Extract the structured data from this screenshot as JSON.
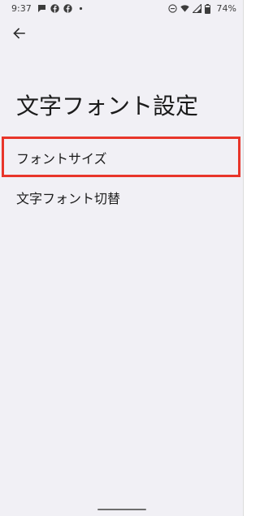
{
  "status_bar": {
    "time": "9:37",
    "battery_percent": "74%",
    "notification_icons": [
      "chat-bubble-icon",
      "facebook-icon",
      "facebook-icon",
      "dot-icon"
    ],
    "system_icons": [
      "do-not-disturb-icon",
      "wifi-icon",
      "signal-icon",
      "battery-icon"
    ]
  },
  "header": {
    "back_icon": "arrow-back-icon",
    "title": "文字フォント設定"
  },
  "settings": {
    "items": [
      {
        "label": "フォントサイズ",
        "highlighted": true
      },
      {
        "label": "文字フォント切替",
        "highlighted": false
      }
    ]
  },
  "colors": {
    "background": "#f1f0f5",
    "highlight_border": "#e8352a",
    "text": "#1b1b1b"
  }
}
